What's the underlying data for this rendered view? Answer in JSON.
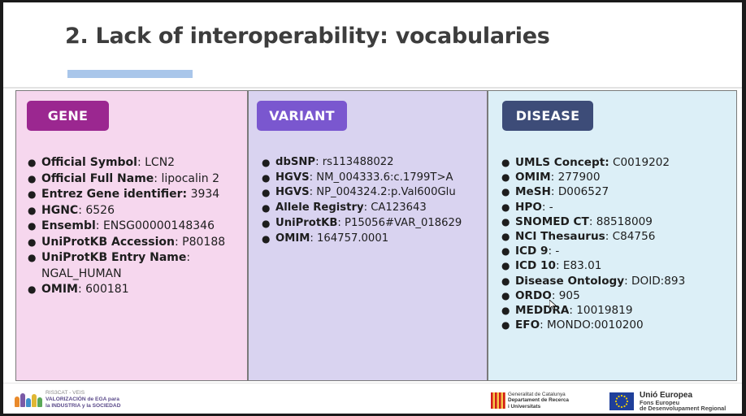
{
  "slide": {
    "title": "2. Lack of interoperability: vocabularies"
  },
  "panels": {
    "gene": {
      "tag": "GENE",
      "items": [
        {
          "label": "Official Symbol",
          "value": ": LCN2"
        },
        {
          "label": "Official Full Name",
          "value": ": lipocalin 2"
        },
        {
          "label": "Entrez Gene identifier:",
          "value": " 3934"
        },
        {
          "label": "HGNC",
          "value": ": 6526"
        },
        {
          "label": "Ensembl",
          "value": ": ENSG00000148346"
        },
        {
          "label": "UniProtKB Accession",
          "value": ": P80188"
        },
        {
          "label": "UniProtKB Entry Name",
          "value": ":",
          "value2": "NGAL_HUMAN"
        },
        {
          "label": "OMIM",
          "value": ": 600181"
        }
      ]
    },
    "variant": {
      "tag": "VARIANT",
      "items": [
        {
          "label": "dbSNP",
          "value": ": rs113488022"
        },
        {
          "label": "HGVS",
          "value": ": NM_004333.6:c.1799T>A"
        },
        {
          "label": "HGVS",
          "value": ": NP_004324.2:p.Val600Glu"
        },
        {
          "label": "Allele Registry",
          "value": ": CA123643"
        },
        {
          "label": "UniProtKB",
          "value": ": P15056#VAR_018629"
        },
        {
          "label": "OMIM",
          "value": ": 164757.0001"
        }
      ]
    },
    "disease": {
      "tag": "DISEASE",
      "items": [
        {
          "label": "UMLS Concept:",
          "value": " C0019202"
        },
        {
          "label": "OMIM",
          "value": ": 277900"
        },
        {
          "label": "MeSH",
          "value": ": D006527"
        },
        {
          "label": "HPO",
          "value": ": -"
        },
        {
          "label": "SNOMED CT",
          "value": ": 88518009"
        },
        {
          "label": "NCI Thesaurus",
          "value": ": C84756"
        },
        {
          "label": "ICD 9",
          "value": ": -"
        },
        {
          "label": "ICD 10",
          "value": ": E83.01"
        },
        {
          "label": "Disease Ontology",
          "value": ": DOID:893"
        },
        {
          "label": "ORDO",
          "value": ": 905"
        },
        {
          "label": "MEDDRA",
          "value": ": 10019819"
        },
        {
          "label": "EFO",
          "value": ": MONDO:0010200"
        }
      ]
    }
  },
  "footer": {
    "left_logo": {
      "line1": "RIS3CAT - VEIS",
      "line2": "VALORIZACIÓN de EGA para",
      "line3": "la INDUSTRIA y la SOCIEDAD"
    },
    "gencat": {
      "line1": "Generalitat de Catalunya",
      "line2": "Departament de Recerca",
      "line3": "i Universitats"
    },
    "eu": {
      "line1": "Unió Europea",
      "line2": "Fons Europeu",
      "line3": "de Desenvolupament Regional"
    }
  },
  "colors": {
    "gene_tag": "#9b2790",
    "variant_tag": "#7a57cf",
    "disease_tag": "#3d4c78",
    "gene_bg": "#f6d7ee",
    "variant_bg": "#d9d3f0",
    "disease_bg": "#dceff7",
    "title_accent": "#a9c6ea"
  }
}
